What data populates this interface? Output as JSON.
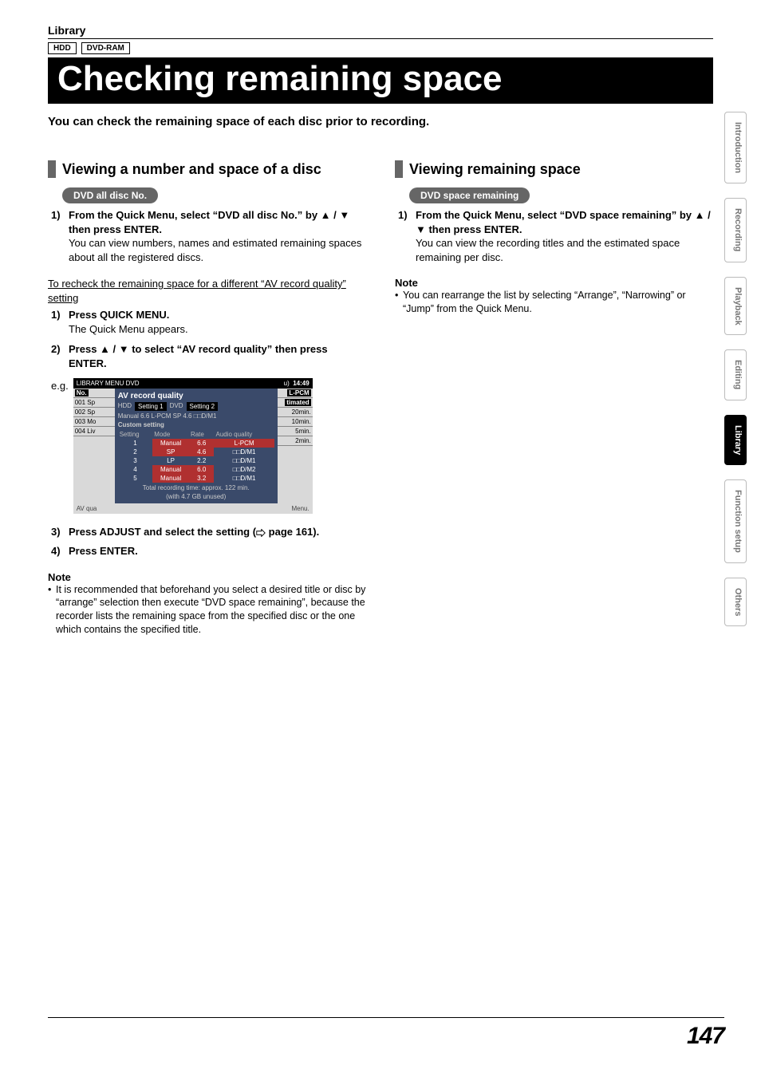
{
  "header": {
    "section": "Library",
    "badges": [
      "HDD",
      "DVD-RAM"
    ],
    "title": "Checking remaining space",
    "intro": "You can check the remaining space of each disc prior to recording."
  },
  "left": {
    "h2": "Viewing a number and space of a disc",
    "pill": "DVD all disc No.",
    "step1_num": "1)",
    "step1_bold": "From the Quick Menu, select “DVD all disc No.” by ▲ / ▼ then press ENTER.",
    "step1_plain": "You can view numbers, names and estimated remaining spaces about all the registered discs.",
    "recheck": "To recheck the remaining space for a different “AV record quality” setting",
    "r_step1_num": "1)",
    "r_step1_bold": "Press QUICK MENU.",
    "r_step1_plain": "The Quick Menu appears.",
    "r_step2_num": "2)",
    "r_step2_bold": "Press ▲ / ▼ to select “AV record quality” then press ENTER.",
    "eg_label": "e.g.",
    "r_step3_num": "3)",
    "r_step3_bold_a": "Press ADJUST and select the setting (",
    "r_step3_bold_b": " page 161).",
    "r_step4_num": "4)",
    "r_step4_bold": "Press ENTER.",
    "note_head": "Note",
    "note_body": "It is recommended that beforehand you select a desired title or disc by “arrange” selection then execute “DVD space remaining”, because the recorder lists the remaining space from the specified disc or the one which contains the specified title."
  },
  "right": {
    "h2": "Viewing remaining space",
    "pill": "DVD space remaining",
    "step1_num": "1)",
    "step1_bold": "From the Quick Menu, select “DVD space remaining” by ▲ / ▼ then press ENTER.",
    "step1_plain": "You can view the recording titles and the estimated space remaining per disc.",
    "note_head": "Note",
    "note_body": "You can rearrange the list by selecting “Arrange”, “Narrowing” or “Jump” from the Quick Menu."
  },
  "osd": {
    "top_left": "LIBRARY MENU  DVD",
    "top_right_u": "u)",
    "top_right_time": "14:49",
    "title": "AV record quality",
    "tab1_pre": "HDD",
    "tab1": "Setting 1",
    "tab2_pre": "DVD",
    "tab2": "Setting 2",
    "line1": "Manual 6.6  L-PCM          SP      4.6 □□D/M1",
    "custom": "Custom setting",
    "headers": [
      "Setting",
      "Mode",
      "Rate",
      "Audio quality"
    ],
    "rows": [
      [
        "1",
        "Manual",
        "6.6",
        "L-PCM"
      ],
      [
        "2",
        "SP",
        "4.6",
        "□□D/M1"
      ],
      [
        "3",
        "LP",
        "2.2",
        "□□D/M1"
      ],
      [
        "4",
        "Manual",
        "6.0",
        "□□D/M2"
      ],
      [
        "5",
        "Manual",
        "3.2",
        "□□D/M1"
      ]
    ],
    "total1": "Total recording time: approx. 122 min.",
    "total2": "(with 4.7 GB unused)",
    "left_no": "No.",
    "left_rows": [
      "001  Sp",
      "002  Sp",
      "003  Mo",
      "004  Liv"
    ],
    "right_head1": "L-PCM",
    "right_head2": "timated",
    "right_rows": [
      "20min.",
      "10min.",
      "5min.",
      "2min."
    ],
    "bottom_left": "AV qua",
    "bottom_right": "Menu."
  },
  "side_tabs": [
    "Introduction",
    "Recording",
    "Playback",
    "Editing",
    "Library",
    "Function setup",
    "Others"
  ],
  "page_number": "147"
}
